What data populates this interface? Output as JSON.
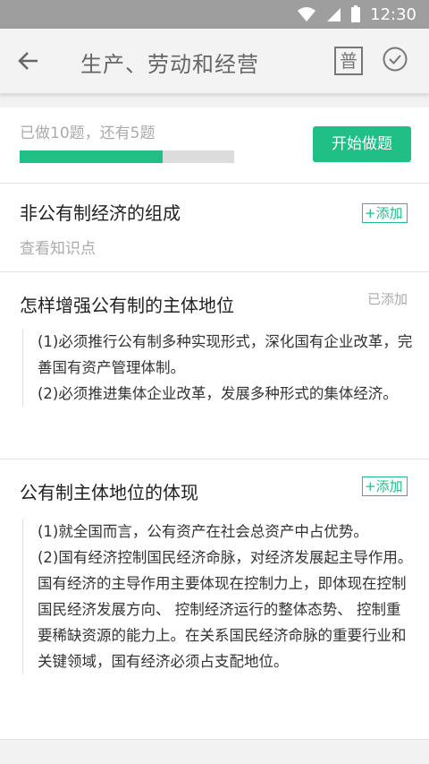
{
  "status_bar": {
    "time": "12:30"
  },
  "app_bar": {
    "title": "生产、劳动和经营",
    "pu_label": "普"
  },
  "progress": {
    "status": "已做10题，还有5题",
    "start_label": "开始做题",
    "fraction": 0.667,
    "color": "#1fbf86"
  },
  "cards": [
    {
      "title": "非公有制经济的组成",
      "action": "+添加",
      "link": "查看知识点"
    },
    {
      "title": "怎样增强公有制的主体地位",
      "action": "已添加",
      "body": [
        "(1)必须推行公有制多种实现形式，深化国有企业改革，完善国有资产管理体制。",
        "(2)必须推进集体企业改革，发展多种形式的集体经济。"
      ]
    },
    {
      "title": "公有制主体地位的体现",
      "action": "+添加",
      "body": [
        "(1)就全国而言，公有资产在社会总资产中占优势。",
        "(2)国有经济控制国民经济命脉，对经济发展起主导作用。国有经济的主导作用主要体现在控制力上，即体现在控制国民经济发展方向、 控制经济运行的整体态势、 控制重要稀缺资源的能力上。在关系国民经济命脉的重要行业和关键领域，国有经济必须占支配地位。"
      ]
    }
  ]
}
